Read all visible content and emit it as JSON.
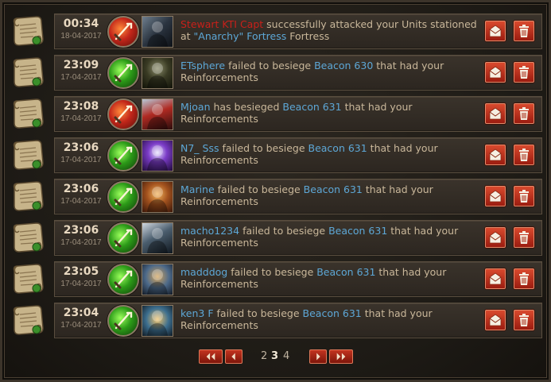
{
  "reports": [
    {
      "time": "00:34",
      "date": "18-04-2017",
      "icon": "attack-icon",
      "icon_color": "red",
      "avatar": "av-1",
      "msg": [
        {
          "t": "Stewart KTI Capt",
          "s": "hr"
        },
        {
          "t": " successfully attacked your Units stationed at ",
          "s": ""
        },
        {
          "t": "\"Anarchy\" Fortress",
          "s": "hl"
        },
        {
          "t": " Fortress",
          "s": ""
        }
      ]
    },
    {
      "time": "23:09",
      "date": "17-04-2017",
      "icon": "siege-icon",
      "icon_color": "green",
      "avatar": "av-2",
      "msg": [
        {
          "t": "ETsphere",
          "s": "hl"
        },
        {
          "t": " failed to besiege ",
          "s": ""
        },
        {
          "t": "Beacon 630",
          "s": "hl"
        },
        {
          "t": " that had your Reinforcements",
          "s": ""
        }
      ]
    },
    {
      "time": "23:08",
      "date": "17-04-2017",
      "icon": "siege-icon",
      "icon_color": "red",
      "avatar": "av-3",
      "msg": [
        {
          "t": "Mjoan",
          "s": "hl"
        },
        {
          "t": " has besieged ",
          "s": ""
        },
        {
          "t": "Beacon 631",
          "s": "hl"
        },
        {
          "t": " that had your Reinforcements",
          "s": ""
        }
      ]
    },
    {
      "time": "23:06",
      "date": "17-04-2017",
      "icon": "siege-icon",
      "icon_color": "green",
      "avatar": "av-4",
      "msg": [
        {
          "t": "N7_ Sss",
          "s": "hl"
        },
        {
          "t": " failed to besiege ",
          "s": ""
        },
        {
          "t": "Beacon 631",
          "s": "hl"
        },
        {
          "t": " that had your Reinforcements",
          "s": ""
        }
      ]
    },
    {
      "time": "23:06",
      "date": "17-04-2017",
      "icon": "siege-icon",
      "icon_color": "green",
      "avatar": "av-5",
      "msg": [
        {
          "t": "Marine",
          "s": "hl"
        },
        {
          "t": " failed to besiege ",
          "s": ""
        },
        {
          "t": "Beacon 631",
          "s": "hl"
        },
        {
          "t": " that had your Reinforcements",
          "s": ""
        }
      ]
    },
    {
      "time": "23:06",
      "date": "17-04-2017",
      "icon": "siege-icon",
      "icon_color": "green",
      "avatar": "av-6",
      "msg": [
        {
          "t": "macho1234",
          "s": "hl"
        },
        {
          "t": " failed to besiege ",
          "s": ""
        },
        {
          "t": "Beacon 631",
          "s": "hl"
        },
        {
          "t": " that had your Reinforcements",
          "s": ""
        }
      ]
    },
    {
      "time": "23:05",
      "date": "17-04-2017",
      "icon": "siege-icon",
      "icon_color": "green",
      "avatar": "av-7",
      "msg": [
        {
          "t": "madddog",
          "s": "hl"
        },
        {
          "t": " failed to besiege ",
          "s": ""
        },
        {
          "t": "Beacon 631",
          "s": "hl"
        },
        {
          "t": " that had your Reinforcements",
          "s": ""
        }
      ]
    },
    {
      "time": "23:04",
      "date": "17-04-2017",
      "icon": "siege-icon",
      "icon_color": "green",
      "avatar": "av-8",
      "msg": [
        {
          "t": "ken3 F",
          "s": "hl"
        },
        {
          "t": " failed to besiege ",
          "s": ""
        },
        {
          "t": "Beacon 631",
          "s": "hl"
        },
        {
          "t": " that had your Reinforcements",
          "s": ""
        }
      ]
    }
  ],
  "row_icons": {
    "scroll": "scroll-icon",
    "mail": "mail-icon",
    "delete": "trash-icon"
  },
  "pagination": {
    "pages": [
      "2",
      "3",
      "4"
    ],
    "current": "3",
    "first_icon": "double-chevron-left-icon",
    "prev_icon": "chevron-left-icon",
    "next_icon": "chevron-right-icon",
    "last_icon": "double-chevron-right-icon"
  },
  "colors": {
    "accent_red": "#c8201a",
    "link_blue": "#5da7d6",
    "text": "#c9b79a",
    "row_bg": "#332d26"
  }
}
